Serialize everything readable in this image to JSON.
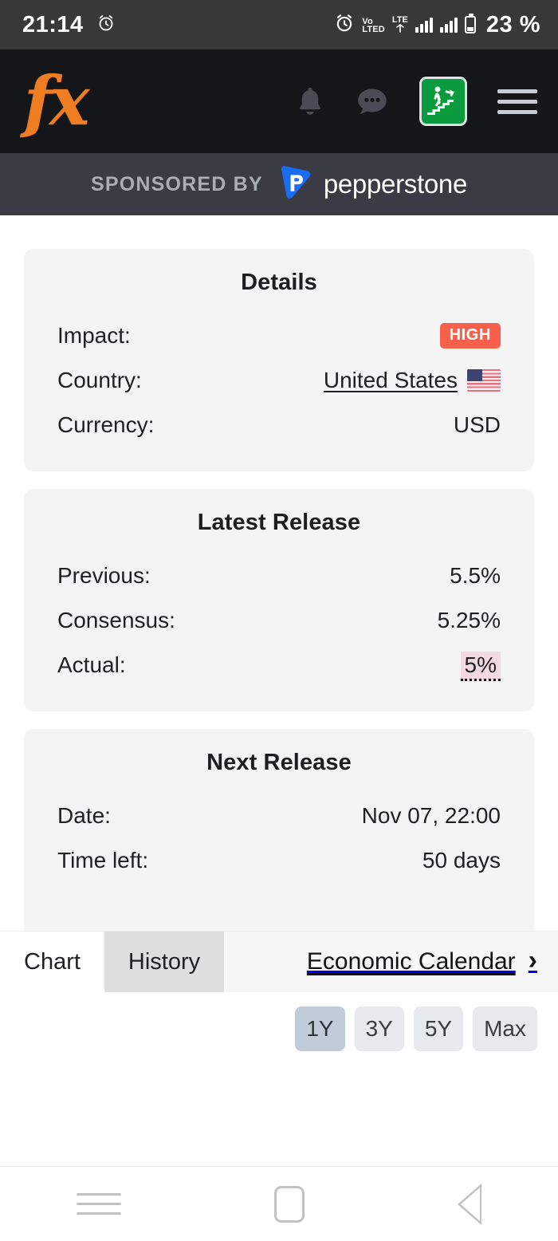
{
  "status_bar": {
    "time": "21:14",
    "alarm_icon": "alarm-clock-icon",
    "volte_line1": "Vo",
    "volte_line2": "LTED",
    "lte_label": "LTE",
    "battery_percent": "23 %"
  },
  "app_header": {
    "logo_text": "fx",
    "logo_color": "#ef7e22",
    "background": "#15161a",
    "icons": [
      {
        "name": "notifications-bell-icon",
        "label": "Notifications"
      },
      {
        "name": "chat-bubble-icon",
        "label": "Chat"
      },
      {
        "name": "emergency-exit-icon",
        "label": "Exit"
      },
      {
        "name": "hamburger-menu-icon",
        "label": "Menu"
      }
    ]
  },
  "sponsor": {
    "prefix": "SPONSORED BY",
    "brand": "pepperstone",
    "brand_mark": "P",
    "brand_color": "#1a6df0",
    "background": "#3a3b45"
  },
  "details_card": {
    "title": "Details",
    "rows": [
      {
        "label": "Impact:",
        "value": "HIGH",
        "type": "badge",
        "badge_color": "#f8604c"
      },
      {
        "label": "Country:",
        "value": "United States",
        "type": "link-flag"
      },
      {
        "label": "Currency:",
        "value": "USD",
        "type": "text"
      }
    ]
  },
  "latest_release_card": {
    "title": "Latest Release",
    "rows": [
      {
        "label": "Previous:",
        "value": "5.5%",
        "type": "text"
      },
      {
        "label": "Consensus:",
        "value": "5.25%",
        "type": "text"
      },
      {
        "label": "Actual:",
        "value": "5%",
        "type": "highlight",
        "highlight_color": "#f4d9e1"
      }
    ]
  },
  "next_release_card": {
    "title": "Next Release",
    "rows": [
      {
        "label": "Date:",
        "value": "Nov 07, 22:00",
        "type": "text"
      },
      {
        "label": "Time left:",
        "value": "50 days",
        "type": "text"
      }
    ]
  },
  "tabs": {
    "items": [
      {
        "label": "Chart",
        "active": true
      },
      {
        "label": "History",
        "active": false
      }
    ],
    "calendar_link": "Economic Calendar",
    "calendar_chevron": "›"
  },
  "chart_panel": {
    "ranges": [
      {
        "label": "1Y",
        "selected": true
      },
      {
        "label": "3Y",
        "selected": false
      },
      {
        "label": "5Y",
        "selected": false
      },
      {
        "label": "Max",
        "selected": false
      }
    ]
  },
  "chart_data": {
    "type": "line",
    "title": "",
    "xlabel": "",
    "ylabel": "",
    "x": [],
    "values": [],
    "note": "Chart area is blank / not yet rendered in the screenshot",
    "selected_range": "1Y"
  },
  "android_nav": {
    "buttons": [
      {
        "name": "recents-button",
        "icon": "recents-icon"
      },
      {
        "name": "home-button",
        "icon": "home-square-icon"
      },
      {
        "name": "back-button",
        "icon": "back-triangle-icon"
      }
    ]
  }
}
